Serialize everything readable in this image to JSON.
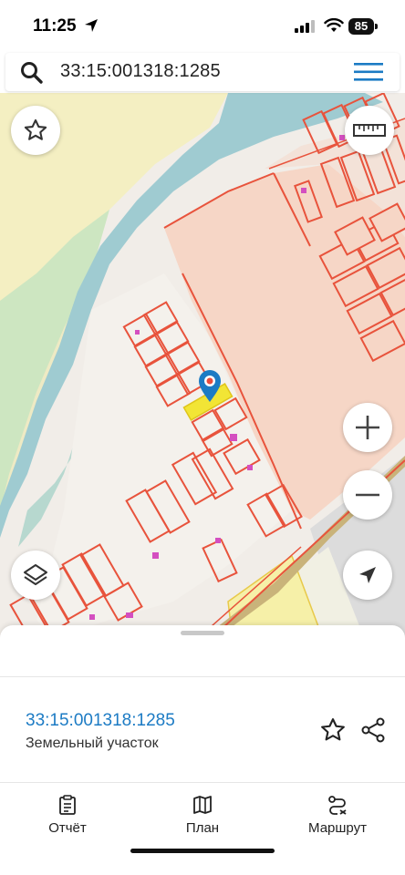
{
  "status_bar": {
    "time": "11:25",
    "battery": "85"
  },
  "search": {
    "query": "33:15:001318:1285"
  },
  "sheet": {
    "parcel_id": "33:15:001318:1285",
    "parcel_type": "Земельный участок"
  },
  "bottom_nav": {
    "items": [
      {
        "label": "Отчёт",
        "icon": "report-icon"
      },
      {
        "label": "План",
        "icon": "map-plan-icon"
      },
      {
        "label": "Маршрут",
        "icon": "route-icon"
      }
    ]
  },
  "colors": {
    "accent": "#1c7bc4",
    "parcel_border": "#e8533c",
    "selected_parcel": "#f2e535",
    "river": "#9fcbd1",
    "meadow": "#f4efc2",
    "zone": "#f6d6c6"
  }
}
